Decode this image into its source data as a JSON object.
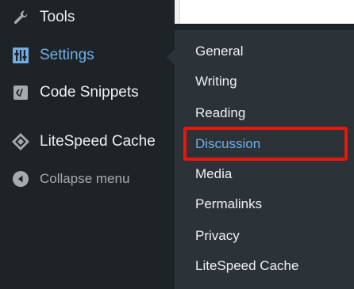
{
  "main_menu": {
    "items": [
      {
        "label": "Tools",
        "icon": "wrench-icon"
      },
      {
        "label": "Settings",
        "icon": "settings-sliders-icon",
        "active": true
      },
      {
        "label": "Code Snippets",
        "icon": "code-snippets-icon"
      },
      {
        "label": "LiteSpeed Cache",
        "icon": "litespeed-diamond-icon"
      }
    ],
    "collapse_label": "Collapse menu",
    "collapse_icon": "collapse-arrow-icon"
  },
  "submenu": {
    "items": [
      {
        "label": "General"
      },
      {
        "label": "Writing"
      },
      {
        "label": "Reading"
      },
      {
        "label": "Discussion",
        "current": true
      },
      {
        "label": "Media"
      },
      {
        "label": "Permalinks"
      },
      {
        "label": "Privacy"
      },
      {
        "label": "LiteSpeed Cache"
      }
    ]
  },
  "colors": {
    "menu_bg": "#1d2327",
    "submenu_bg": "#2c3338",
    "active_text": "#72aee6",
    "highlight_border": "#e8170c"
  }
}
